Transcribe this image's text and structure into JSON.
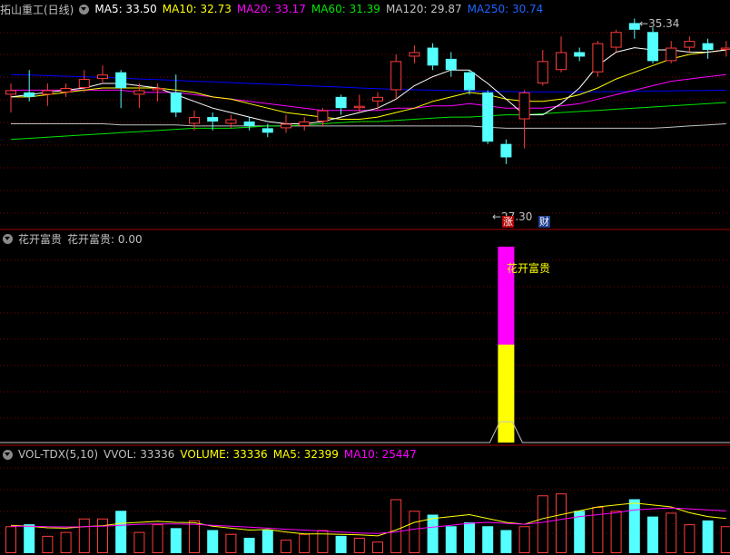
{
  "colors": {
    "up": "#ff3c3c",
    "down": "#54ffff",
    "ma5": "#ffffff",
    "ma10": "#ffff00",
    "ma20": "#ff00ff",
    "ma60": "#00e600",
    "ma120": "#c0c0c0",
    "ma250": "#0000ff",
    "grid": "#7a0000"
  },
  "kline": {
    "stock_name": "拓山重工(日线)",
    "ma": [
      {
        "label": "MA5: 33.50",
        "color": "#ffffff"
      },
      {
        "label": "MA10: 32.73",
        "color": "#ffff00"
      },
      {
        "label": "MA20: 33.17",
        "color": "#ff00ff"
      },
      {
        "label": "MA60: 31.39",
        "color": "#00e600"
      },
      {
        "label": "MA120: 29.87",
        "color": "#c0c0c0"
      },
      {
        "label": "MA250: 30.74",
        "color": "#0000ff"
      }
    ],
    "high_label": "35.34",
    "low_label": "27.30",
    "badge_zhang": "涨",
    "badge_cai": "财",
    "menu_icon": "chevron-down-icon"
  },
  "chart_data": [
    {
      "type": "candlestick",
      "title": "拓山重工(日线)",
      "ylim": [
        26.6,
        36.0
      ],
      "candles": [
        {
          "o": 32.5,
          "c": 32.7,
          "h": 33.0,
          "l": 31.7
        },
        {
          "o": 32.6,
          "c": 32.4,
          "h": 33.6,
          "l": 32.2
        },
        {
          "o": 32.5,
          "c": 32.7,
          "h": 33.0,
          "l": 32.0
        },
        {
          "o": 32.6,
          "c": 32.8,
          "h": 33.0,
          "l": 32.4
        },
        {
          "o": 32.8,
          "c": 33.2,
          "h": 33.6,
          "l": 32.6
        },
        {
          "o": 33.2,
          "c": 33.4,
          "h": 33.8,
          "l": 33.0
        },
        {
          "o": 33.5,
          "c": 32.8,
          "h": 33.6,
          "l": 31.9
        },
        {
          "o": 32.5,
          "c": 32.7,
          "h": 33.0,
          "l": 31.9
        },
        {
          "o": 32.7,
          "c": 32.8,
          "h": 33.0,
          "l": 32.2
        },
        {
          "o": 32.6,
          "c": 31.7,
          "h": 33.4,
          "l": 31.5
        },
        {
          "o": 31.2,
          "c": 31.5,
          "h": 31.8,
          "l": 30.9
        },
        {
          "o": 31.5,
          "c": 31.3,
          "h": 31.7,
          "l": 30.9
        },
        {
          "o": 31.2,
          "c": 31.4,
          "h": 31.6,
          "l": 31.0
        },
        {
          "o": 31.3,
          "c": 31.1,
          "h": 31.5,
          "l": 30.9
        },
        {
          "o": 31.0,
          "c": 30.8,
          "h": 31.2,
          "l": 30.6
        },
        {
          "o": 31.0,
          "c": 31.2,
          "h": 31.6,
          "l": 30.8
        },
        {
          "o": 31.1,
          "c": 31.3,
          "h": 31.5,
          "l": 30.9
        },
        {
          "o": 31.3,
          "c": 31.8,
          "h": 31.9,
          "l": 31.1
        },
        {
          "o": 32.4,
          "c": 31.9,
          "h": 32.5,
          "l": 31.6
        },
        {
          "o": 31.9,
          "c": 32.0,
          "h": 32.5,
          "l": 31.7
        },
        {
          "o": 32.2,
          "c": 32.4,
          "h": 32.6,
          "l": 31.8
        },
        {
          "o": 32.7,
          "c": 34.0,
          "h": 34.3,
          "l": 32.3
        },
        {
          "o": 34.2,
          "c": 34.4,
          "h": 34.7,
          "l": 33.9
        },
        {
          "o": 34.6,
          "c": 33.8,
          "h": 34.8,
          "l": 33.6
        },
        {
          "o": 34.1,
          "c": 33.6,
          "h": 34.4,
          "l": 33.3
        },
        {
          "o": 33.5,
          "c": 32.7,
          "h": 33.6,
          "l": 32.5
        },
        {
          "o": 32.6,
          "c": 30.4,
          "h": 32.7,
          "l": 30.3
        },
        {
          "o": 30.3,
          "c": 29.7,
          "h": 30.5,
          "l": 29.4
        },
        {
          "o": 31.4,
          "c": 32.6,
          "h": 32.7,
          "l": 30.1
        },
        {
          "o": 33.0,
          "c": 34.0,
          "h": 34.5,
          "l": 32.9
        },
        {
          "o": 33.6,
          "c": 34.4,
          "h": 35.1,
          "l": 33.5
        },
        {
          "o": 34.4,
          "c": 34.2,
          "h": 34.6,
          "l": 34.0
        },
        {
          "o": 33.5,
          "c": 34.8,
          "h": 34.9,
          "l": 33.3
        },
        {
          "o": 34.6,
          "c": 35.3,
          "h": 35.4,
          "l": 34.4
        },
        {
          "o": 35.7,
          "c": 35.4,
          "h": 35.9,
          "l": 35.0
        },
        {
          "o": 35.3,
          "c": 34.0,
          "h": 35.5,
          "l": 33.9
        },
        {
          "o": 34.0,
          "c": 34.6,
          "h": 34.9,
          "l": 33.9
        },
        {
          "o": 34.6,
          "c": 34.9,
          "h": 35.1,
          "l": 34.4
        },
        {
          "o": 34.8,
          "c": 34.5,
          "h": 35.0,
          "l": 34.1
        },
        {
          "o": 34.5,
          "c": 34.6,
          "h": 34.9,
          "l": 34.2
        }
      ],
      "ma_series": [
        {
          "name": "MA5",
          "values": [
            32.4,
            32.5,
            32.6,
            32.7,
            32.8,
            33.0,
            33.0,
            32.9,
            32.8,
            32.5,
            32.2,
            31.9,
            31.7,
            31.5,
            31.3,
            31.2,
            31.2,
            31.3,
            31.5,
            31.7,
            31.9,
            32.3,
            32.9,
            33.3,
            33.6,
            33.6,
            33.0,
            32.3,
            31.6,
            31.6,
            32.1,
            32.8,
            33.8,
            34.4,
            34.6,
            34.5,
            34.5,
            34.4,
            34.4,
            34.5
          ]
        },
        {
          "name": "MA10",
          "values": [
            32.4,
            32.4,
            32.5,
            32.6,
            32.7,
            32.8,
            32.8,
            32.8,
            32.8,
            32.7,
            32.6,
            32.4,
            32.3,
            32.1,
            31.9,
            31.7,
            31.6,
            31.5,
            31.4,
            31.4,
            31.5,
            31.7,
            31.9,
            32.2,
            32.4,
            32.6,
            32.5,
            32.3,
            32.2,
            32.2,
            32.3,
            32.5,
            32.8,
            33.2,
            33.5,
            33.8,
            34.1,
            34.3,
            34.4,
            34.5
          ]
        },
        {
          "name": "MA20",
          "values": [
            32.7,
            32.7,
            32.7,
            32.7,
            32.7,
            32.7,
            32.7,
            32.6,
            32.6,
            32.6,
            32.5,
            32.4,
            32.3,
            32.2,
            32.1,
            32.0,
            31.9,
            31.8,
            31.8,
            31.8,
            31.8,
            31.9,
            31.9,
            32.0,
            32.0,
            32.1,
            32.0,
            31.9,
            31.9,
            31.9,
            32.0,
            32.1,
            32.3,
            32.5,
            32.7,
            32.9,
            33.1,
            33.2,
            33.3,
            33.4
          ]
        },
        {
          "name": "MA60",
          "values": [
            30.5,
            30.55,
            30.6,
            30.65,
            30.7,
            30.75,
            30.8,
            30.85,
            30.9,
            30.95,
            31.0,
            31.0,
            31.0,
            31.05,
            31.1,
            31.1,
            31.15,
            31.2,
            31.25,
            31.3,
            31.3,
            31.35,
            31.4,
            31.45,
            31.5,
            31.5,
            31.55,
            31.6,
            31.6,
            31.65,
            31.7,
            31.75,
            31.8,
            31.85,
            31.9,
            31.95,
            32.0,
            32.05,
            32.1,
            32.15
          ]
        },
        {
          "name": "MA120",
          "values": [
            31.2,
            31.2,
            31.2,
            31.2,
            31.2,
            31.2,
            31.15,
            31.15,
            31.15,
            31.15,
            31.1,
            31.1,
            31.1,
            31.1,
            31.1,
            31.1,
            31.1,
            31.1,
            31.1,
            31.1,
            31.1,
            31.1,
            31.1,
            31.1,
            31.1,
            31.1,
            31.05,
            31.0,
            31.0,
            31.0,
            31.0,
            31.0,
            31.0,
            31.0,
            31.0,
            31.0,
            31.05,
            31.1,
            31.15,
            31.2
          ]
        },
        {
          "name": "MA250",
          "values": [
            33.4,
            33.38,
            33.35,
            33.32,
            33.3,
            33.27,
            33.24,
            33.2,
            33.17,
            33.14,
            33.1,
            33.07,
            33.04,
            33.0,
            32.97,
            32.94,
            32.9,
            32.87,
            32.84,
            32.8,
            32.77,
            32.74,
            32.72,
            32.7,
            32.68,
            32.66,
            32.65,
            32.64,
            32.63,
            32.62,
            32.62,
            32.62,
            32.63,
            32.64,
            32.65,
            32.66,
            32.67,
            32.68,
            32.69,
            32.7
          ]
        }
      ]
    },
    {
      "type": "bar",
      "title": "花开富贵",
      "signal_index": 27,
      "signal_label": "花开富贵",
      "segments": [
        {
          "color": "#ffff00",
          "value": 0.5
        },
        {
          "color": "#ff00ff",
          "value": 0.5
        }
      ]
    },
    {
      "type": "bar",
      "title": "VOL-TDX(5,10)",
      "ylim": [
        0,
        48000
      ],
      "values": [
        14000,
        15000,
        9000,
        11000,
        18000,
        18000,
        22000,
        11000,
        15000,
        13000,
        17000,
        12000,
        10000,
        8000,
        12000,
        7000,
        10000,
        12000,
        9000,
        8000,
        6000,
        28000,
        22000,
        20000,
        14000,
        16000,
        14000,
        12000,
        14000,
        30000,
        31000,
        22000,
        24000,
        22000,
        28000,
        19000,
        21000,
        15000,
        17000,
        14000
      ],
      "ma5": [
        14500,
        14000,
        13200,
        13000,
        13800,
        14200,
        15500,
        16000,
        16500,
        16000,
        15800,
        14000,
        13000,
        12000,
        12300,
        11000,
        10000,
        10000,
        9800,
        9500,
        9000,
        12000,
        16000,
        18000,
        19000,
        20000,
        18000,
        16000,
        15000,
        18000,
        20000,
        22000,
        24000,
        25000,
        26000,
        25000,
        24000,
        21000,
        19000,
        18000
      ],
      "ma10": [
        14000,
        14000,
        13800,
        13600,
        13800,
        14000,
        14500,
        15000,
        15200,
        15200,
        15000,
        14500,
        14000,
        13500,
        13000,
        12400,
        12000,
        11500,
        11000,
        10500,
        10200,
        11000,
        12500,
        13500,
        14500,
        15500,
        16000,
        15500,
        15000,
        16000,
        17500,
        19000,
        20000,
        21000,
        22500,
        23000,
        23500,
        23000,
        22500,
        22000
      ]
    }
  ],
  "signal_panel": {
    "name": "花开富贵",
    "label": "花开富贵: 0.00",
    "color": "#ffff00"
  },
  "volume_panel": {
    "name": "VOL-TDX(5,10)",
    "items": [
      {
        "label": "VVOL: 33336",
        "color": "#c0c0c0"
      },
      {
        "label": "VOLUME: 33336",
        "color": "#ffff00"
      },
      {
        "label": "MA5: 32399",
        "color": "#ffff00"
      },
      {
        "label": "MA10: 25447",
        "color": "#ff00ff"
      }
    ]
  }
}
